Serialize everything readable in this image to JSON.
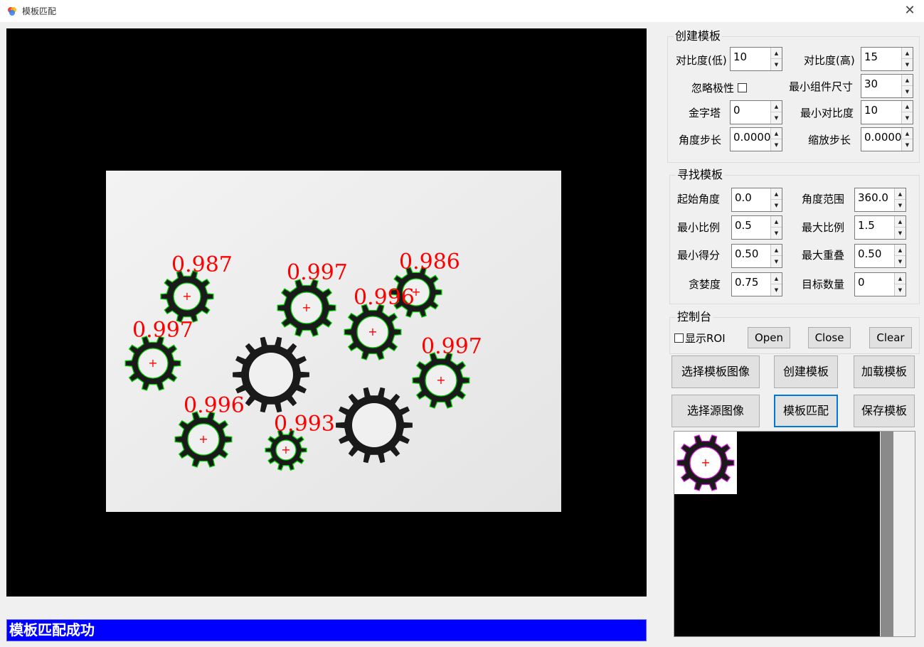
{
  "window": {
    "title": "模板匹配",
    "close_glyph": "✕"
  },
  "viewer": {
    "scores": [
      "0.987",
      "0.997",
      "0.986",
      "0.996",
      "0.997",
      "0.997",
      "0.996",
      "0.993"
    ],
    "cross_glyph": "+"
  },
  "status_text": "模板匹配成功",
  "create_group": {
    "title": "创建模板",
    "contrast_low_label": "对比度(低)",
    "contrast_low": "10",
    "contrast_high_label": "对比度(高)",
    "contrast_high": "15",
    "ignore_polarity_label": "忽略极性",
    "min_component_label": "最小组件尺寸",
    "min_component": "30",
    "pyramid_label": "金字塔",
    "pyramid": "0",
    "min_contrast_label": "最小对比度",
    "min_contrast": "10",
    "angle_step_label": "角度步长",
    "angle_step": "0.0000",
    "scale_step_label": "缩放步长",
    "scale_step": "0.0000"
  },
  "find_group": {
    "title": "寻找模板",
    "start_angle_label": "起始角度",
    "start_angle": "0.0",
    "angle_range_label": "角度范围",
    "angle_range": "360.0",
    "min_scale_label": "最小比例",
    "min_scale": "0.5",
    "max_scale_label": "最大比例",
    "max_scale": "1.5",
    "min_score_label": "最小得分",
    "min_score": "0.50",
    "max_overlap_label": "最大重叠",
    "max_overlap": "0.50",
    "greediness_label": "贪婪度",
    "greediness": "0.75",
    "num_matches_label": "目标数量",
    "num_matches": "0"
  },
  "console_group": {
    "title": "控制台",
    "show_roi_label": "显示ROI",
    "open_label": "Open",
    "close_label": "Close",
    "clear_label": "Clear"
  },
  "buttons": {
    "select_template_image": "选择模板图像",
    "create_template": "创建模板",
    "load_template": "加载模板",
    "select_source_image": "选择源图像",
    "template_match": "模板匹配",
    "save_template": "保存模板"
  },
  "colors": {
    "status_bg": "#0000ff",
    "score_text": "#ff0000",
    "contour": "#00c800",
    "focus_border": "#0078d7"
  }
}
